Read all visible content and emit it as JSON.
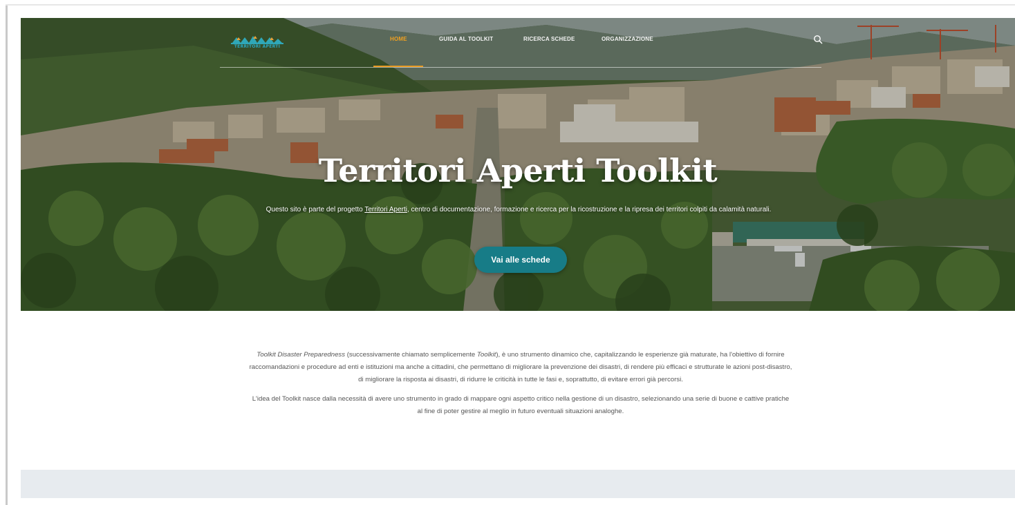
{
  "nav": {
    "logo_text": "TERRITORI APERTI",
    "items": [
      {
        "label": "HOME",
        "active": true
      },
      {
        "label": "GUIDA AL TOOLKIT",
        "active": false
      },
      {
        "label": "RICERCA SCHEDE",
        "active": false
      },
      {
        "label": "ORGANIZZAZIONE",
        "active": false
      }
    ],
    "search_icon": "search-icon",
    "active_color": "#f0a020"
  },
  "hero": {
    "title": "Territori Aperti Toolkit",
    "subtitle_before": "Questo sito è parte del progetto ",
    "subtitle_link": "Territori Aperti",
    "subtitle_after": ", centro di documentazione, formazione e ricerca per la ricostruzione e la ripresa dei territori colpiti da calamità naturali.",
    "cta_label": "Vai alle schede",
    "cta_color": "#177c87"
  },
  "intro": {
    "p1_em1": "Toolkit Disaster Preparedness",
    "p1_text1": " (successivamente chiamato semplicemente ",
    "p1_em2": "Toolkit",
    "p1_text2": "), è uno strumento dinamico che, capitalizzando le esperienze già maturate, ha l'obiettivo di fornire raccomandazioni e procedure ad enti e istituzioni ma anche a cittadini, che permettano di migliorare la prevenzione dei disastri, di rendere più efficaci e strutturate le azioni post-disastro, di migliorare la risposta ai disastri, di ridurre le criticità in tutte le fasi e, soprattutto, di evitare errori già percorsi.",
    "p2": "L'idea del Toolkit nasce dalla necessità di avere uno strumento in grado di mappare ogni aspetto critico nella gestione di un disastro, selezionando una serie di buone e cattive pratiche al fine di poter gestire al meglio in futuro eventuali situazioni analoghe."
  }
}
